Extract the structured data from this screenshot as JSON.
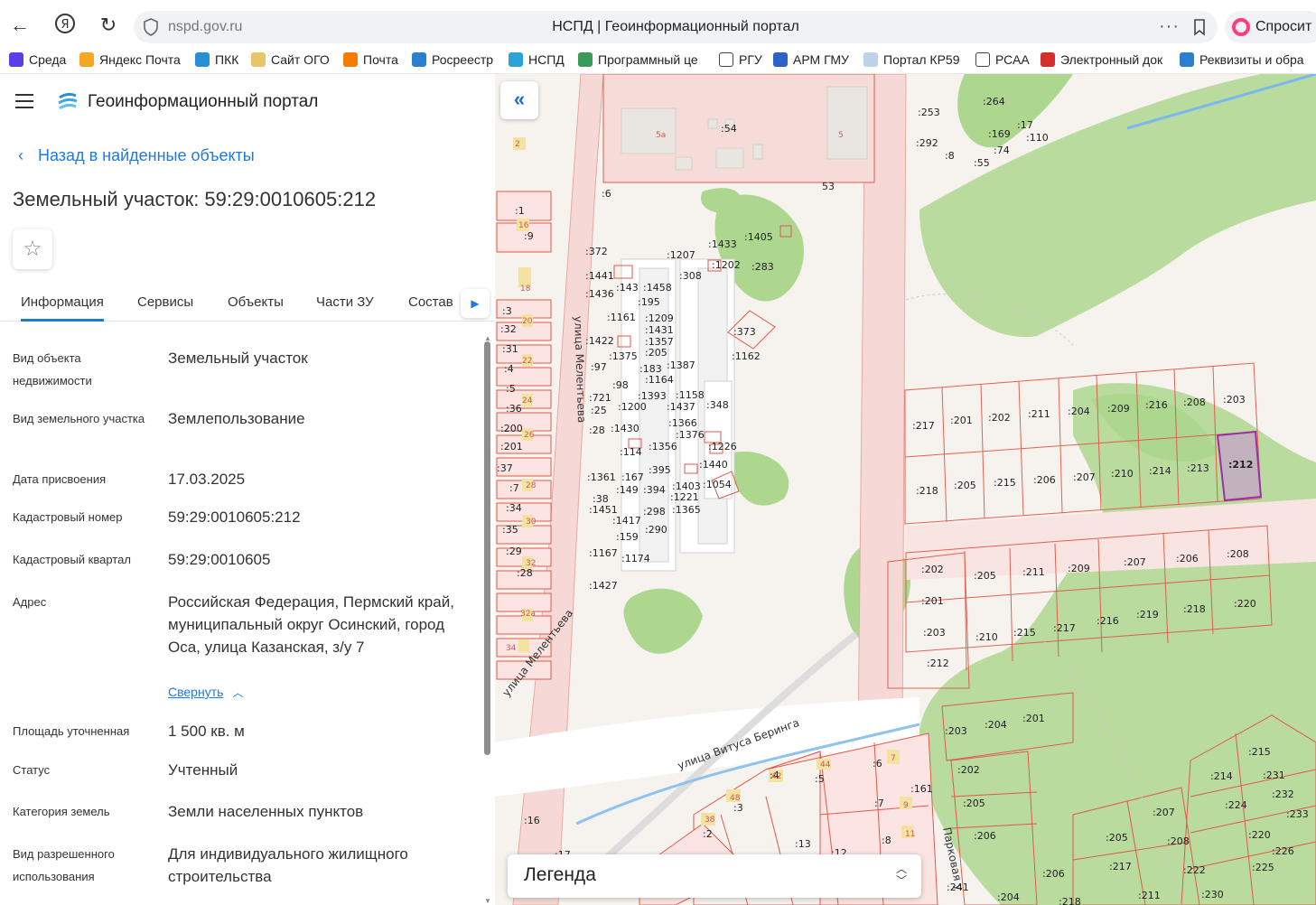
{
  "browser": {
    "url": "nspd.gov.ru",
    "title": "НСПД | Геоинформационный портал",
    "more": "···",
    "ask_label": "Спросит"
  },
  "bookmarks": [
    {
      "label": "Среда",
      "color": "#5a3ee8"
    },
    {
      "label": "Яндекс Почта",
      "color": "#f5a623"
    },
    {
      "label": "ПКК",
      "color": "#2b8fd8"
    },
    {
      "label": "Сайт ОГО",
      "color": "#e8c46a"
    },
    {
      "label": "Почта",
      "color": "#f57c00"
    },
    {
      "label": "Росреестр",
      "color": "#2a7fd0"
    },
    {
      "label": "НСПД",
      "color": "#2ba3d8"
    },
    {
      "label": "Программный це",
      "color": "#3a9a5a"
    },
    {
      "label": "РГУ",
      "color": "#ffffff"
    },
    {
      "label": "АРМ ГМУ",
      "color": "#2a62c8"
    },
    {
      "label": "Портал КР59",
      "color": "#bcd3ea"
    },
    {
      "label": "РСАА",
      "color": "#ffffff"
    },
    {
      "label": "Электронный док",
      "color": "#d32f2f"
    },
    {
      "label": "Реквизиты и обра",
      "color": "#2a7fd0"
    }
  ],
  "panel": {
    "portal_name": "Геоинформационный портал",
    "back_label": "Назад в найденные объекты",
    "object_title": "Земельный участок: 59:29:0010605:212",
    "tabs": [
      "Информация",
      "Сервисы",
      "Объекты",
      "Части ЗУ",
      "Состав"
    ],
    "properties": [
      {
        "label": "Вид объекта недвижимости",
        "value": "Земельный участок"
      },
      {
        "label": "Вид земельного участка",
        "value": "Землепользование"
      },
      {
        "label": "Дата присвоения",
        "value": "17.03.2025"
      },
      {
        "label": "Кадастровый номер",
        "value": "59:29:0010605:212"
      },
      {
        "label": "Кадастровый квартал",
        "value": "59:29:0010605"
      },
      {
        "label": "Адрес",
        "value": "Российская Федерация, Пермский край, муниципальный округ Осинский, город Оса, улица Казанская, з/у 7"
      },
      {
        "label": "Площадь уточненная",
        "value": "1 500 кв. м"
      },
      {
        "label": "Статус",
        "value": "Учтенный"
      },
      {
        "label": "Категория земель",
        "value": "Земли населенных пунктов"
      },
      {
        "label": "Вид разрешенного использования",
        "value": "Для индивидуального жилищного строительства"
      }
    ],
    "collapse_label": "Свернуть"
  },
  "map": {
    "legend_title": "Легенда",
    "streets": [
      "улица Мелентьева",
      "улица Мелентьева",
      "улица Витуса Беринга",
      "Парковая у"
    ],
    "selected_parcel": ":212",
    "accent": "#1f7ae0",
    "parcel_stroke": "#e05a4a",
    "selected_stroke": "#9b2fa8",
    "greenery": "#a9d58a"
  }
}
